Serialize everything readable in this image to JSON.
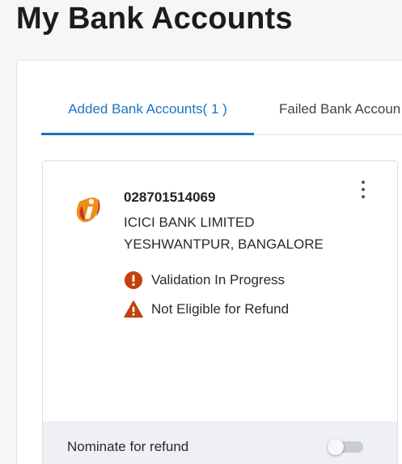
{
  "page": {
    "title": "My Bank Accounts"
  },
  "tabs": [
    {
      "label": "Added Bank Accounts( 1 )",
      "active": true
    },
    {
      "label": "Failed Bank Accoun",
      "active": false
    }
  ],
  "account": {
    "logo_icon": "icici-bank-logo",
    "number": "028701514069",
    "bank_name": "ICICI BANK LIMITED",
    "branch": "YESHWANTPUR, BANGALORE",
    "statuses": [
      {
        "icon": "exclamation-circle-icon",
        "text": "Validation In Progress",
        "color": "#c2410c"
      },
      {
        "icon": "warning-triangle-icon",
        "text": "Not Eligible for Refund",
        "color": "#c2410c"
      }
    ]
  },
  "nominate": {
    "label": "Nominate for refund",
    "enabled": false
  },
  "colors": {
    "accent": "#1e73be",
    "status_orange": "#c2410c",
    "brand_orange": "#f28c1a",
    "brand_red": "#b5182b"
  }
}
